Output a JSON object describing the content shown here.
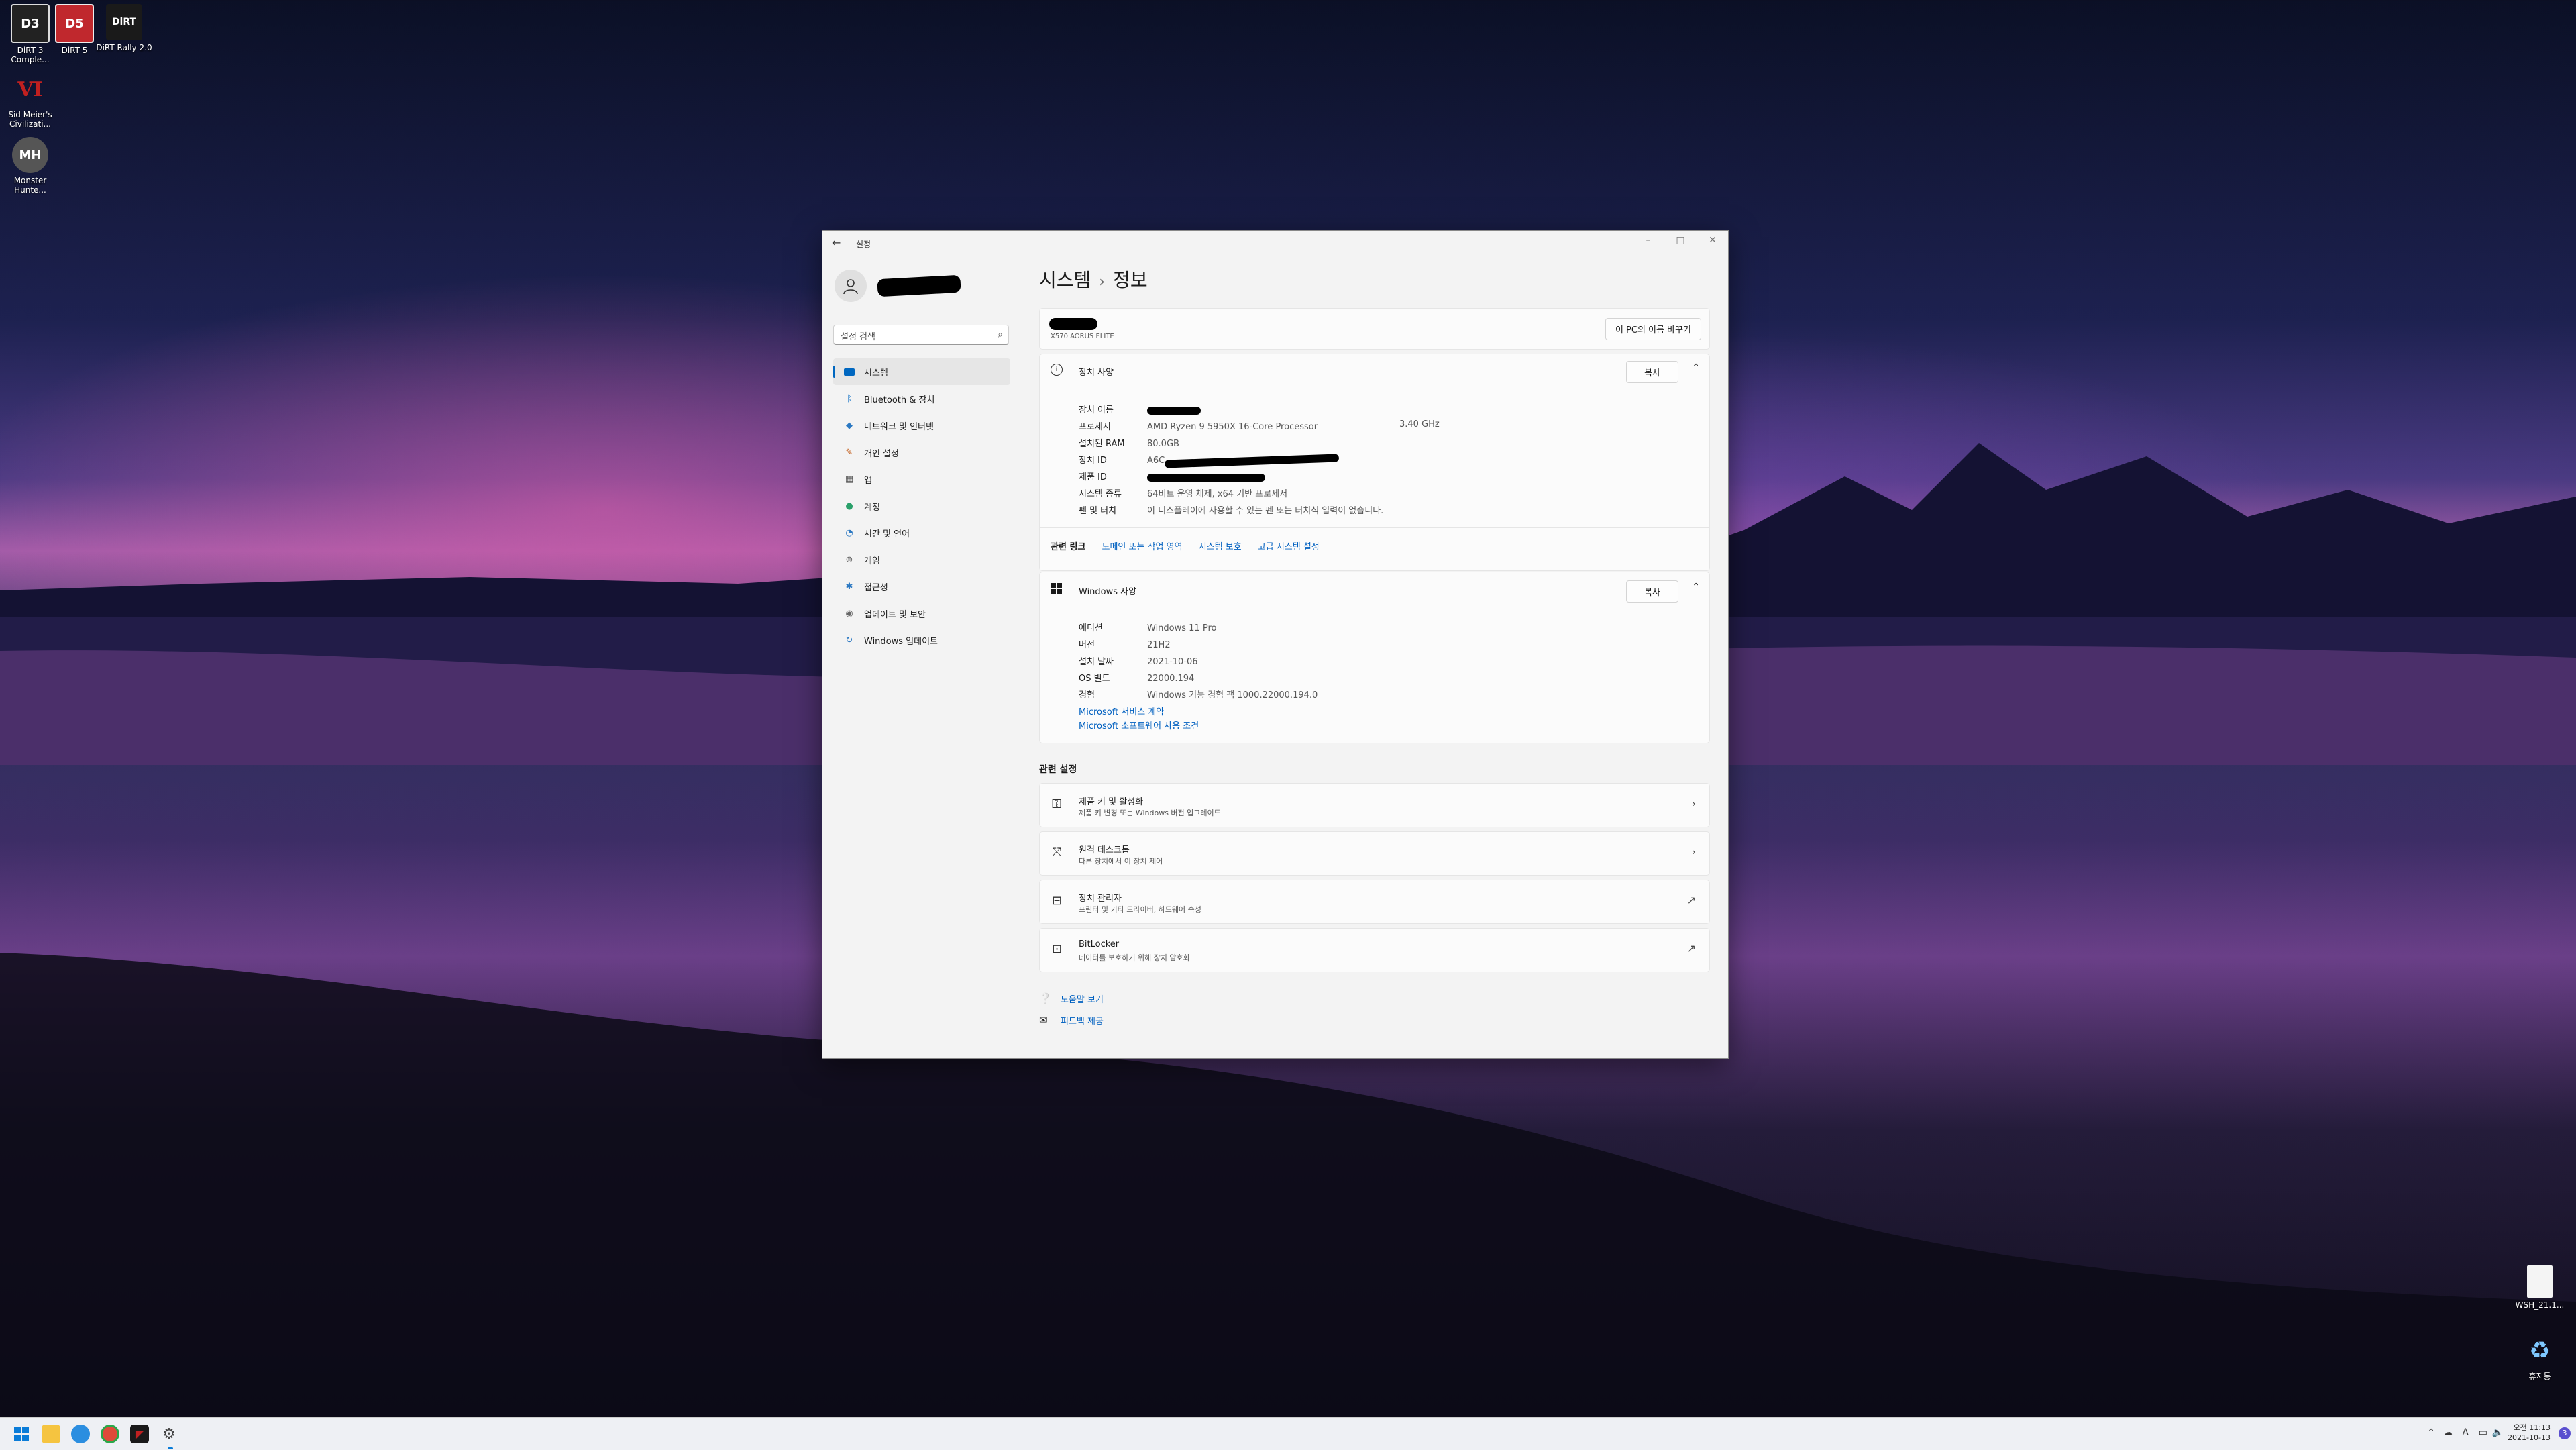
{
  "desktop": {
    "icons_left": [
      {
        "label": "DiRT 3 Comple...",
        "glyph": "D3",
        "color": "#222"
      },
      {
        "label": "DiRT 5",
        "glyph": "D5",
        "color": "#c0282d"
      },
      {
        "label": "DiRT Rally 2.0",
        "glyph": "DiRT",
        "color": "#1a1a1a"
      },
      {
        "label": "Sid Meier's Civilizati...",
        "glyph": "VI",
        "color": "#3a1010"
      },
      {
        "label": "Monster Hunte...",
        "glyph": "MH",
        "color": "#555"
      }
    ],
    "icons_right": [
      {
        "label": "WSH_21.1...",
        "glyph": "file-icon"
      },
      {
        "label": "휴지통",
        "glyph": "recycle-bin-icon"
      }
    ]
  },
  "window": {
    "app_title": "설정",
    "back_icon": "back-arrow-icon",
    "controls": [
      "minimize",
      "maximize",
      "close"
    ],
    "sidebar": {
      "search_placeholder": "설정 검색",
      "items": [
        {
          "label": "시스템",
          "icon": "system-icon",
          "color": "#0067c0",
          "active": true
        },
        {
          "label": "Bluetooth & 장치",
          "icon": "bluetooth-icon",
          "color": "#0067c0"
        },
        {
          "label": "네트워크 및 인터넷",
          "icon": "network-icon",
          "color": "#2b78c2"
        },
        {
          "label": "개인 설정",
          "icon": "personalize-icon",
          "color": "#c15a16"
        },
        {
          "label": "앱",
          "icon": "apps-icon",
          "color": "#555"
        },
        {
          "label": "계정",
          "icon": "account-icon",
          "color": "#2aa06a"
        },
        {
          "label": "시간 및 언어",
          "icon": "time-language-icon",
          "color": "#2b78c2"
        },
        {
          "label": "게임",
          "icon": "gaming-icon",
          "color": "#666"
        },
        {
          "label": "접근성",
          "icon": "accessibility-icon",
          "color": "#2b78c2"
        },
        {
          "label": "업데이트 및 보안",
          "icon": "shield-icon",
          "color": "#666"
        },
        {
          "label": "Windows 업데이트",
          "icon": "update-icon",
          "color": "#2b78c2"
        }
      ]
    },
    "breadcrumb": {
      "parent": "시스템",
      "sep": "›",
      "current": "정보"
    },
    "device_header": {
      "model": "X570 AORUS ELITE",
      "rename_button": "이 PC의 이름 바꾸기"
    },
    "device_specs": {
      "title": "장치 사양",
      "copy_button": "복사",
      "rows": [
        {
          "key": "장치 이름",
          "value": ""
        },
        {
          "key": "프로세서",
          "value": "AMD Ryzen 9 5950X 16-Core Processor",
          "extra": "3.40 GHz"
        },
        {
          "key": "설치된 RAM",
          "value": "80.0GB"
        },
        {
          "key": "장치 ID",
          "value": "A6C"
        },
        {
          "key": "제품 ID",
          "value": ""
        },
        {
          "key": "시스템 종류",
          "value": "64비트 운영 체제, x64 기반 프로세서"
        },
        {
          "key": "펜 및 터치",
          "value": "이 디스플레이에 사용할 수 있는 펜 또는 터치식 입력이 없습니다."
        }
      ],
      "related_links_label": "관련 링크",
      "related_links": [
        "도메인 또는 작업 영역",
        "시스템 보호",
        "고급 시스템 설정"
      ]
    },
    "windows_specs": {
      "title": "Windows 사양",
      "copy_button": "복사",
      "rows": [
        {
          "key": "에디션",
          "value": "Windows 11 Pro"
        },
        {
          "key": "버전",
          "value": "21H2"
        },
        {
          "key": "설치 날짜",
          "value": "2021-10-06"
        },
        {
          "key": "OS 빌드",
          "value": "22000.194"
        },
        {
          "key": "경험",
          "value": "Windows 기능 경험 팩 1000.22000.194.0"
        }
      ],
      "links": [
        "Microsoft 서비스 계약",
        "Microsoft 소프트웨어 사용 조건"
      ]
    },
    "related_settings": {
      "title": "관련 설정",
      "items": [
        {
          "title": "제품 키 및 활성화",
          "subtitle": "제품 키 변경 또는 Windows 버전 업그레이드",
          "icon": "key-icon",
          "arrow": "›"
        },
        {
          "title": "원격 데스크톱",
          "subtitle": "다른 장치에서 이 장치 제어",
          "icon": "remote-desktop-icon",
          "arrow": "›"
        },
        {
          "title": "장치 관리자",
          "subtitle": "프린터 및 기타 드라이버, 하드웨어 속성",
          "icon": "device-manager-icon",
          "arrow": "↗"
        },
        {
          "title": "BitLocker",
          "subtitle": "데이터를 보호하기 위해 장치 암호화",
          "icon": "bitlocker-icon",
          "arrow": "↗"
        }
      ]
    },
    "footer_links": [
      {
        "label": "도움말 보기",
        "icon": "help-icon"
      },
      {
        "label": "피드백 제공",
        "icon": "feedback-icon"
      }
    ]
  },
  "taskbar": {
    "clock_time": "오전 11:13",
    "clock_date": "2021-10-13",
    "ime": "A",
    "notification_count": "3"
  }
}
